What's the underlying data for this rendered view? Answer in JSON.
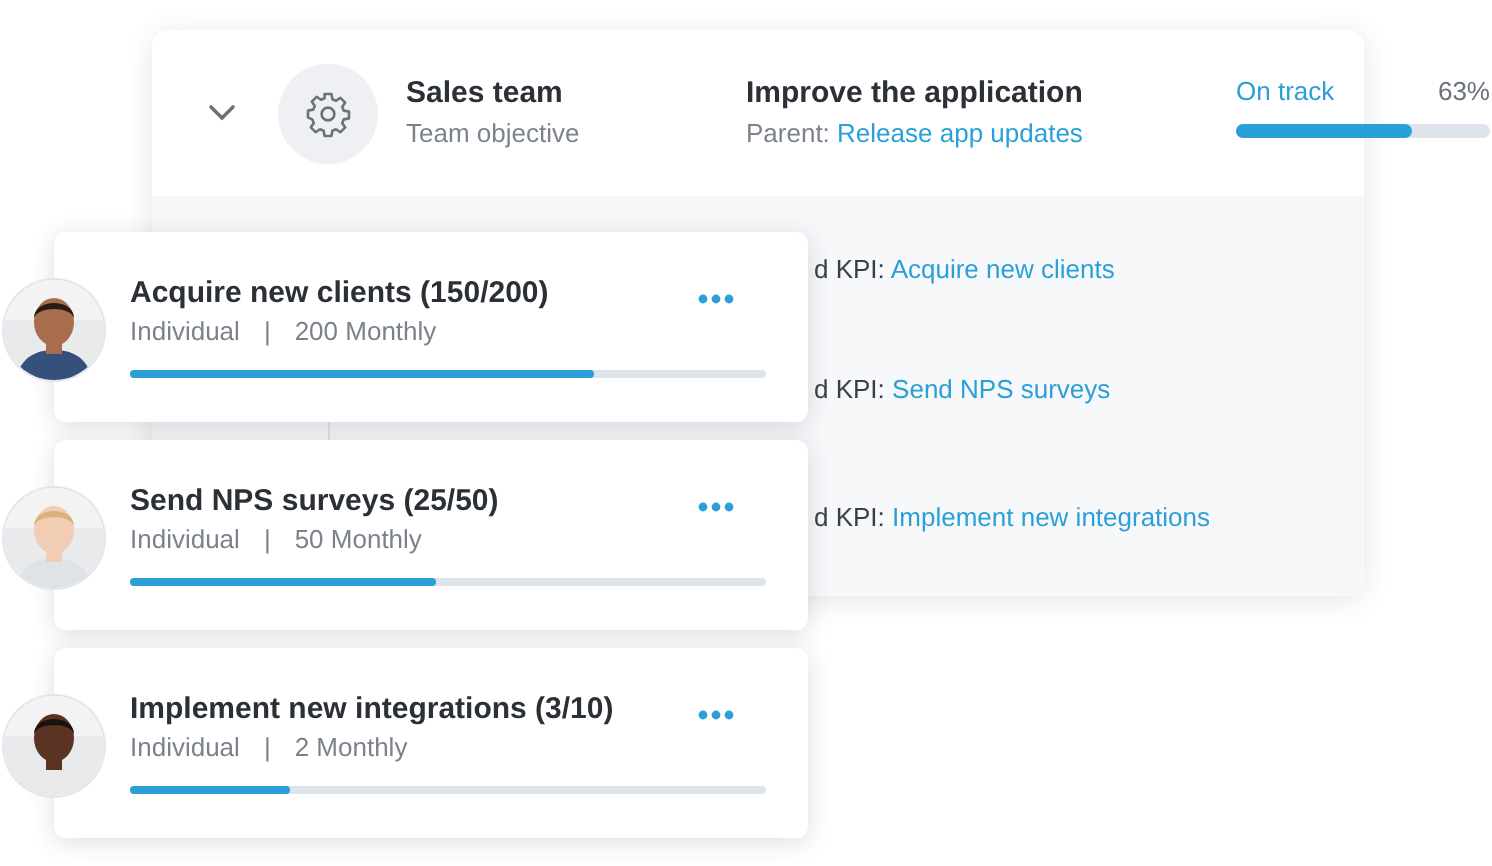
{
  "objective": {
    "expanded": true,
    "team": "Sales team",
    "team_role": "Team objective",
    "title": "Improve the application",
    "parent_label": "Parent:",
    "parent_link": "Release app updates",
    "status": "On track",
    "percent": "63%",
    "level": 0.69
  },
  "linked_kpis": [
    {
      "label": "d KPI:",
      "link": "Acquire new clients"
    },
    {
      "label": "d KPI:",
      "link": "Send NPS surveys"
    },
    {
      "label": "d KPI:",
      "link": "Implement new integrations"
    }
  ],
  "kpi_cards": [
    {
      "title": "Acquire new clients (150/200)",
      "type": "Individual",
      "separator": "|",
      "target": "200 Monthly",
      "level": 0.73
    },
    {
      "title": "Send NPS surveys (25/50)",
      "type": "Individual",
      "separator": "|",
      "target": "50 Monthly",
      "level": 0.48
    },
    {
      "title": "Implement new integrations (3/10)",
      "type": "Individual",
      "separator": "|",
      "target": "2 Monthly",
      "level": 0.25
    }
  ]
}
